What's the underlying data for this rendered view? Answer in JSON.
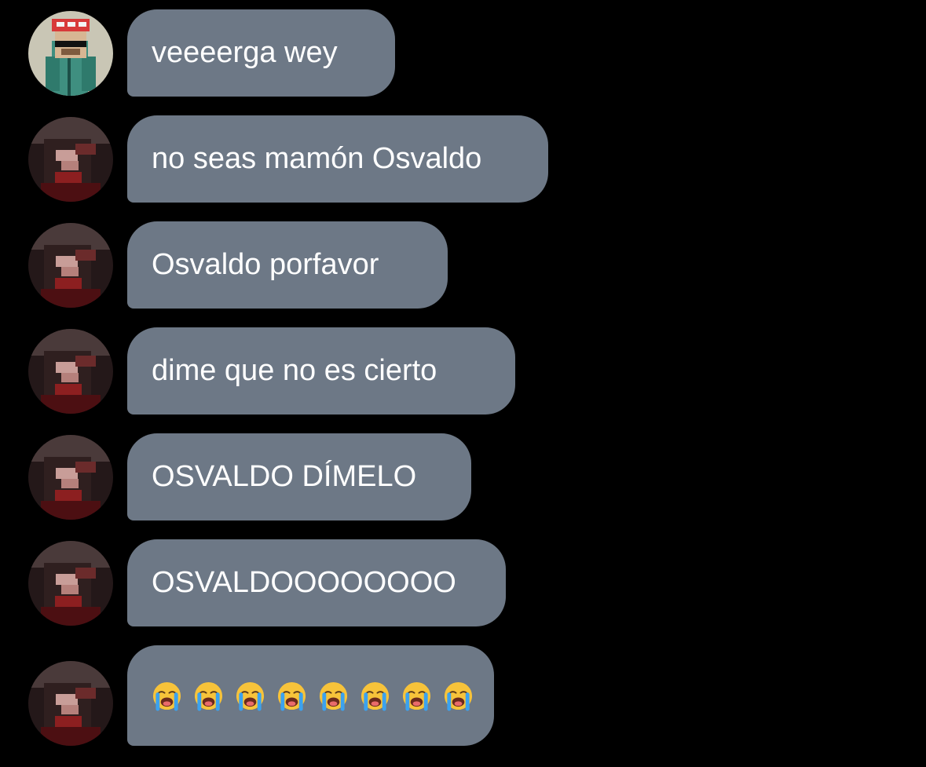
{
  "messages": [
    {
      "text": "veeeerga wey",
      "avatar": "minecraft-avatar-icon",
      "width": 341
    },
    {
      "text": "no seas mamón Osvaldo",
      "avatar": "dark-red-avatar-icon",
      "width": 536
    },
    {
      "text": "Osvaldo porfavor",
      "avatar": "dark-red-avatar-icon",
      "width": 408
    },
    {
      "text": "dime que no es cierto",
      "avatar": "dark-red-avatar-icon",
      "width": 494
    },
    {
      "text": "OSVALDO DÍMELO",
      "avatar": "dark-red-avatar-icon",
      "width": 438
    },
    {
      "text": "OSVALDOOOOOOOO",
      "avatar": "dark-red-avatar-icon",
      "width": 482
    },
    {
      "emoji": "loudly-crying-face-icon",
      "emoji_count": 8,
      "avatar": "dark-red-avatar-icon"
    }
  ],
  "colors": {
    "background": "#000000",
    "bubble": "#6d7886",
    "text": "#ffffff"
  }
}
